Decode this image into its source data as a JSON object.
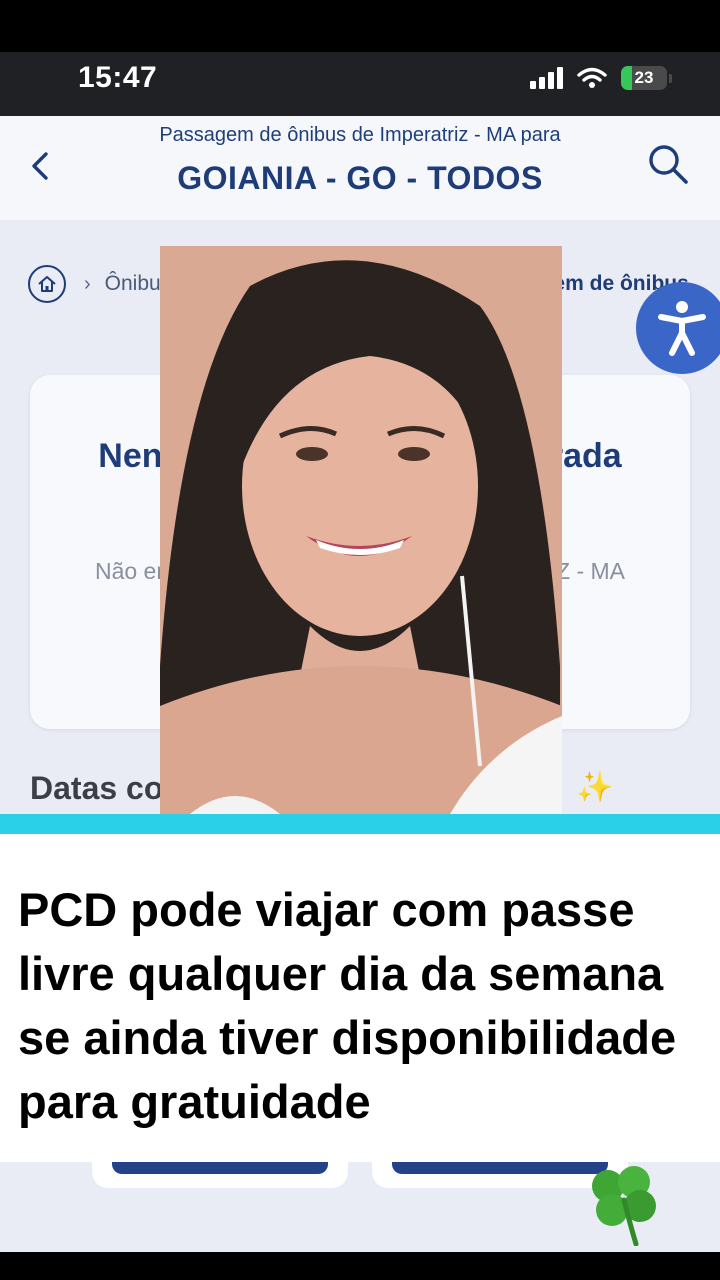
{
  "status_bar": {
    "time": "15:47",
    "battery_level": "23",
    "battery_fraction": 0.23,
    "icons": [
      "cellular-signal-icon",
      "wifi-icon",
      "battery-charging-icon"
    ]
  },
  "header": {
    "subtitle": "Passagem de ônibus de Imperatriz - MA para",
    "title": "GOIANIA - GO - TODOS",
    "back_icon": "chevron-left-icon",
    "search_icon": "search-icon"
  },
  "breadcrumb": {
    "home_icon": "home-icon",
    "items": [
      {
        "label": "Ônibus para Goiania - GO - TODOS"
      },
      {
        "label": "Passagem de ônibus"
      }
    ]
  },
  "accessibility": {
    "icon": "accessibility-icon"
  },
  "result_card": {
    "title": "Nenhuma passagem encontrada",
    "message": "Não encontramos passagens de IMPERATRIZ - MA para GOIANIA - GO - TODOS"
  },
  "dates_heading": "Datas com passagens disponíveis",
  "caption": {
    "text": "PCD pode viajar com passe livre qualquer dia da semana se ainda tiver disponibilidade para gratuidade"
  },
  "overlay": {
    "person": "woman-talking-video-overlay",
    "sticker": "four-leaf-clover-sticker"
  },
  "colors": {
    "brand_blue": "#1e3c78",
    "accessibility_blue": "#3a66c8",
    "caption_bar": "#2ad0e8",
    "page_background": "#e9ebf5"
  }
}
